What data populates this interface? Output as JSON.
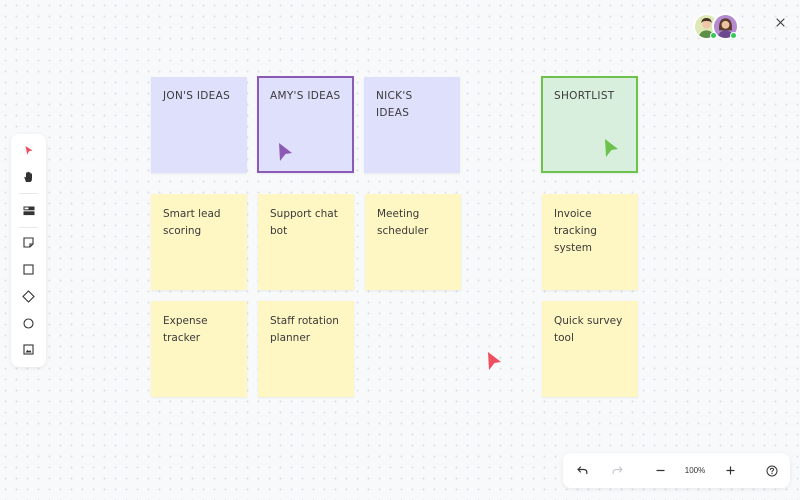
{
  "board": {
    "headers": [
      {
        "label": "JON'S IDEAS"
      },
      {
        "label": "AMY'S IDEAS"
      },
      {
        "label": "NICK'S IDEAS"
      },
      {
        "label": "SHORTLIST"
      }
    ],
    "notes": {
      "jon": [
        "Smart lead scoring",
        "Expense tracker"
      ],
      "amy": [
        "Support chat bot",
        "Staff rotation planner"
      ],
      "nick": [
        "Meeting scheduler"
      ],
      "shortlist": [
        "Invoice tracking system",
        "Quick survey tool"
      ]
    }
  },
  "toolbar": {
    "tools": [
      "pointer-icon",
      "hand-icon",
      "template-icon",
      "sticky-note-icon",
      "rectangle-icon",
      "diamond-icon",
      "circle-icon",
      "image-icon"
    ]
  },
  "zoom": {
    "level": "100%"
  },
  "colors": {
    "header_note": "#dfe0fb",
    "idea_note": "#fef7c3",
    "shortlist_note": "#d9efdd",
    "amy_accent": "#8c5ab4",
    "shortlist_accent": "#6cc24a",
    "red_cursor": "#ef4f5e"
  }
}
